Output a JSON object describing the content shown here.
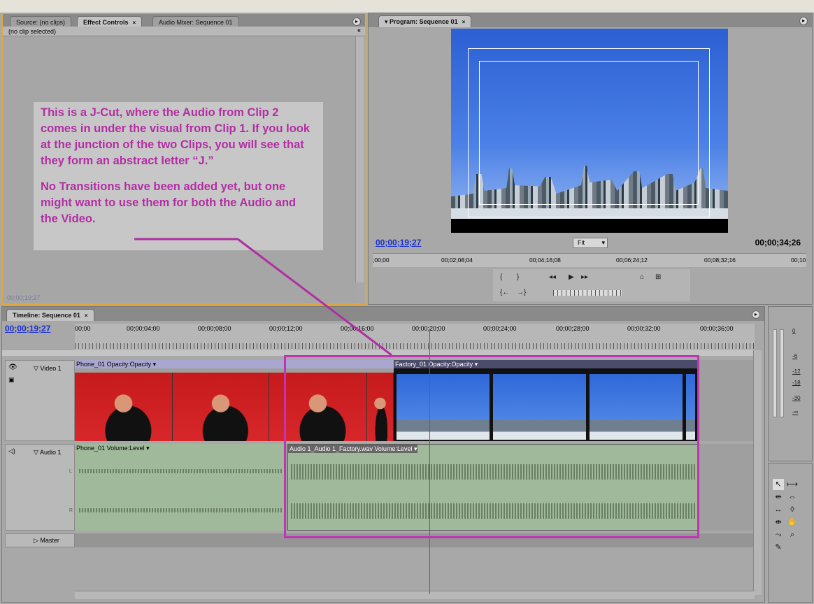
{
  "source_panel": {
    "tabs": [
      {
        "label": "Source: (no clips)"
      },
      {
        "label": "Effect Controls",
        "close": "×"
      },
      {
        "label": "Audio Mixer: Sequence 01"
      }
    ],
    "header_text": "(no clip selected)",
    "timecode": "00;00;19;27",
    "collapse_glyph": "«"
  },
  "callout": {
    "paragraph1": "This is a J-Cut, where the Audio from Clip 2 comes in under the visual from Clip 1. If you look at the junction of the two Clips, you will see that they form an abstract letter “J.”",
    "paragraph2": "No Transitions have been added yet, but one might want to use them for both the Audio and the Video.",
    "color": "#b22ea3"
  },
  "program_panel": {
    "tab_label": "Program: Sequence 01",
    "tab_close": "×",
    "current_timecode": "00;00;19;27",
    "duration_timecode": "00;00;34;26",
    "zoom_select": "Fit",
    "ruler_ticks": [
      ";00;00",
      "00;02;08;04",
      "00;04;16;08",
      "00;06;24;12",
      "00;08;32;16",
      "00;10"
    ]
  },
  "timeline": {
    "tab_label": "Timeline: Sequence 01",
    "tab_close": "×",
    "current_timecode": "00;00;19;27",
    "ruler_ticks": [
      "00;00",
      "00;00;04;00",
      "00;00;08;00",
      "00;00;12;00",
      "00;00;16;00",
      "00;00;20;00",
      "00;00;24;00",
      "00;00;28;00",
      "00;00;32;00",
      "00;00;36;00"
    ],
    "tracks": {
      "video1": {
        "name": "Video 1",
        "clips": [
          {
            "name": "Phone_01",
            "effect": "Opacity:Opacity"
          },
          {
            "name": "Factory_01",
            "effect": "Opacity:Opacity"
          }
        ]
      },
      "audio1": {
        "name": "Audio 1",
        "clips": [
          {
            "name": "Phone_01",
            "effect": "Volume:Level"
          },
          {
            "name": "Audio 1_Audio 1_Factory.wav",
            "effect": "Volume:Level"
          }
        ],
        "channel_left": "L",
        "channel_right": "R"
      },
      "master": {
        "name": "Master"
      }
    },
    "playhead_color": "#e52b1f",
    "highlight_color": "#c035b3"
  },
  "meters": {
    "labels": [
      "0",
      "-6",
      "-12",
      "-18",
      "-30",
      "-∞"
    ]
  },
  "icons": [
    "close-icon",
    "panel-menu-icon",
    "play-icon",
    "step-back-icon",
    "step-forward-icon",
    "hand-icon",
    "zoom-icon",
    "selection-tool-icon",
    "razor-icon",
    "eye-icon",
    "speaker-icon",
    "lock-icon"
  ]
}
